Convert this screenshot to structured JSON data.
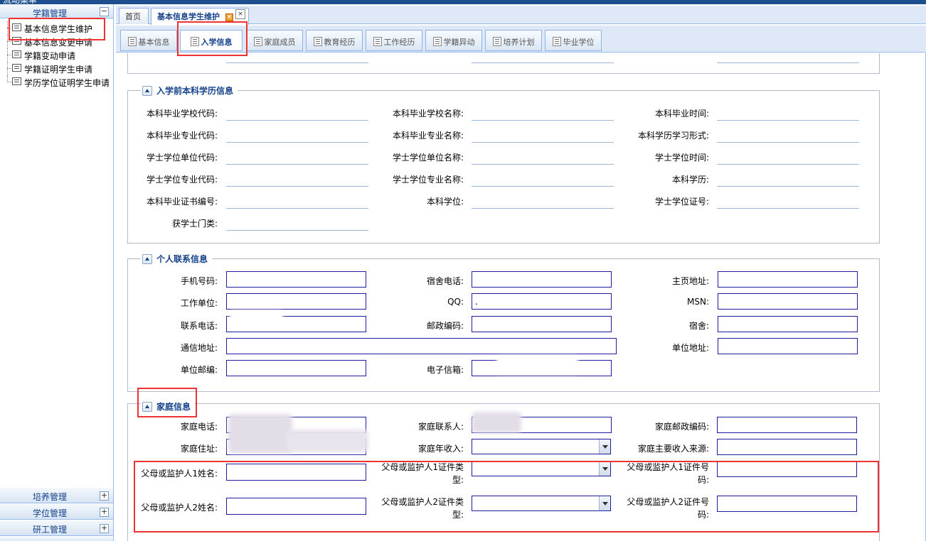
{
  "app": {
    "title": "流动菜单"
  },
  "sidebar": {
    "section_top": "学籍管理",
    "items": [
      {
        "label": "基本信息学生维护"
      },
      {
        "label": "基本信息变更申请"
      },
      {
        "label": "学籍变动申请"
      },
      {
        "label": "学籍证明学生申请"
      },
      {
        "label": "学历学位证明学生申请"
      }
    ],
    "sections_bottom": [
      {
        "label": "培养管理"
      },
      {
        "label": "学位管理"
      },
      {
        "label": "研工管理"
      }
    ]
  },
  "outer_tabs": [
    {
      "label": "首页"
    },
    {
      "label": "基本信息学生维护"
    }
  ],
  "inner_tabs": [
    {
      "label": "基本信息"
    },
    {
      "label": "入学信息"
    },
    {
      "label": "家庭成员"
    },
    {
      "label": "教育经历"
    },
    {
      "label": "工作经历"
    },
    {
      "label": "学籍异动"
    },
    {
      "label": "培养计划"
    },
    {
      "label": "毕业学位"
    }
  ],
  "undergrad": {
    "title": "入学前本科学历信息",
    "fields": {
      "school_code": "本科毕业学校代码:",
      "school_name": "本科毕业学校名称:",
      "grad_time": "本科毕业时间:",
      "major_code": "本科毕业专业代码:",
      "major_name": "本科毕业专业名称:",
      "study_form": "本科学历学习形式:",
      "degree_unit_code": "学士学位单位代码:",
      "degree_unit_name": "学士学位单位名称:",
      "degree_time": "学士学位时间:",
      "degree_major_code": "学士学位专业代码:",
      "degree_major_name": "学士学位专业名称:",
      "education": "本科学历:",
      "cert_no": "本科毕业证书编号:",
      "degree": "本科学位:",
      "degree_cert_no": "学士学位证号:",
      "degree_category": "获学士门类:"
    }
  },
  "contact": {
    "title": "个人联系信息",
    "fields": {
      "mobile": "手机号码:",
      "dorm_phone": "宿舍电话:",
      "homepage": "主页地址:",
      "employer": "工作单位:",
      "qq": "QQ:",
      "msn": "MSN:",
      "phone": "联系电话:",
      "postcode": "邮政编码:",
      "dorm": "宿舍:",
      "mail_address": "通信地址:",
      "work_address": "单位地址:",
      "work_postcode": "单位邮编:",
      "email": "电子信箱:"
    },
    "values": {
      "qq": "."
    }
  },
  "family": {
    "title": "家庭信息",
    "fields": {
      "home_phone": "家庭电话:",
      "contact_person": "家庭联系人:",
      "home_postcode": "家庭邮政编码:",
      "home_address": "家庭住址:",
      "annual_income": "家庭年收入:",
      "income_source": "家庭主要收入来源:",
      "guardian1_name": "父母或监护人1姓名:",
      "guardian1_idtype_a": "父母或监护人1证件类",
      "guardian1_idtype_b": "型:",
      "guardian1_idno_a": "父母或监护人1证件号",
      "guardian1_idno_b": "码:",
      "guardian2_name": "父母或监护人2姓名:",
      "guardian2_idtype_a": "父母或监护人2证件类",
      "guardian2_idtype_b": "型:",
      "guardian2_idno_a": "父母或监护人2证件号",
      "guardian2_idno_b": "码:"
    }
  },
  "colors": {
    "accent": "#15428b",
    "highlight": "#e33333",
    "input_border": "#1d1d9f"
  }
}
